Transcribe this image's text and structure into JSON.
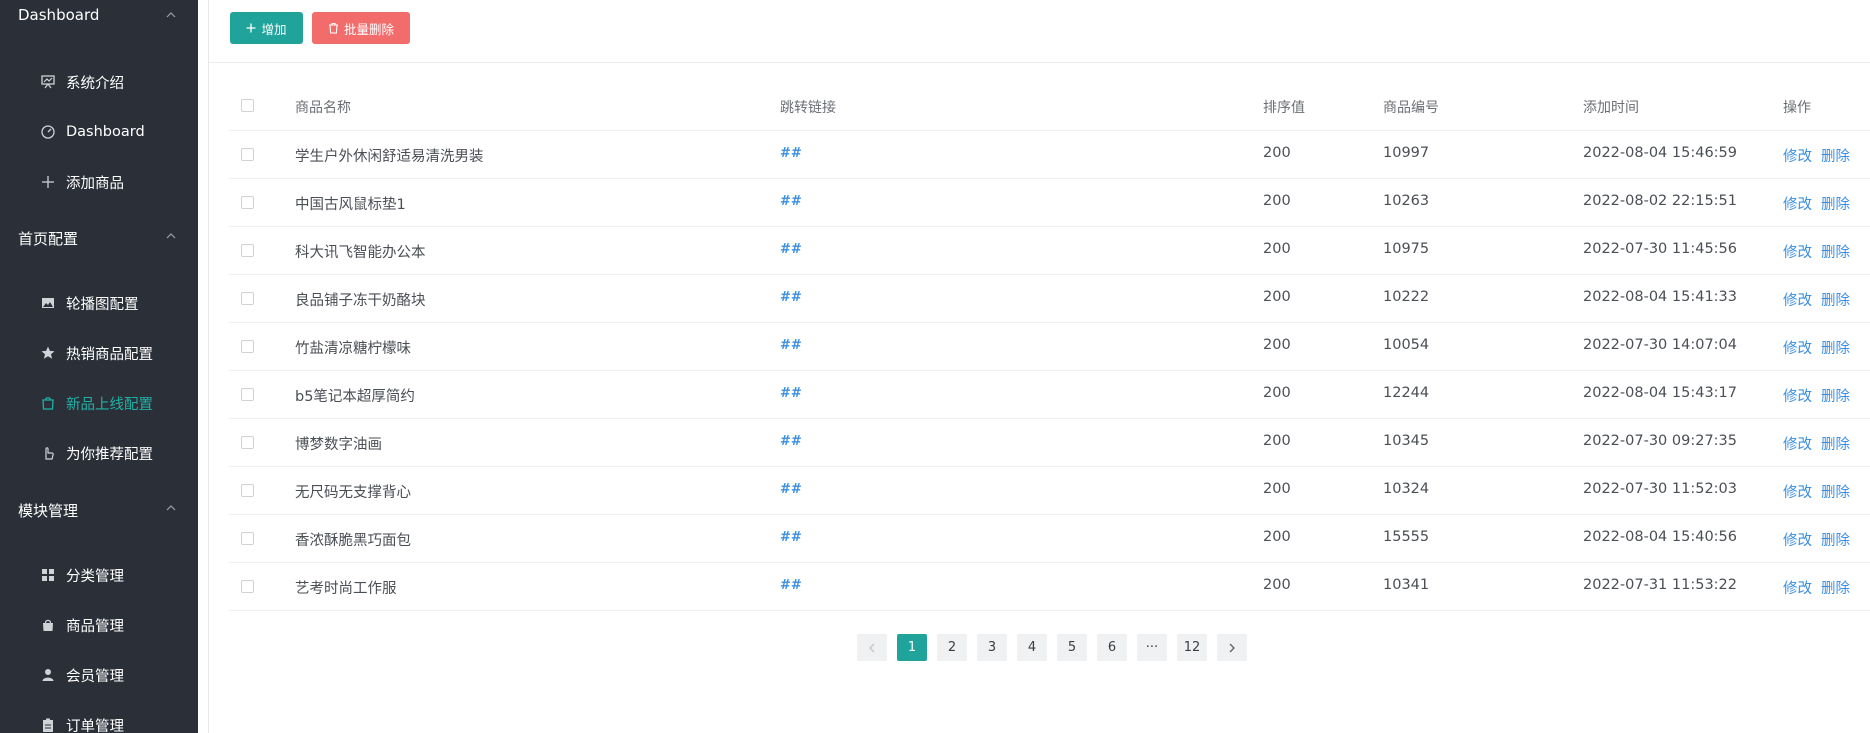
{
  "sidebar": {
    "groups": [
      {
        "title": "Dashboard",
        "items": [
          "系统介绍",
          "Dashboard",
          "添加商品"
        ]
      },
      {
        "title": "首页配置",
        "items": [
          "轮播图配置",
          "热销商品配置",
          "新品上线配置",
          "为你推荐配置"
        ]
      },
      {
        "title": "模块管理",
        "items": [
          "分类管理",
          "商品管理",
          "会员管理",
          "订单管理"
        ]
      }
    ],
    "active_item": "新品上线配置",
    "active_color": "#20b1a5"
  },
  "toolbar": {
    "add_label": "增加",
    "batch_delete_label": "批量删除"
  },
  "table": {
    "headers": [
      "商品名称",
      "跳转链接",
      "排序值",
      "商品编号",
      "添加时间",
      "操作"
    ],
    "rows": [
      {
        "name": "学生户外休闲舒适易清洗男装",
        "link": "##",
        "order": "200",
        "id": "10997",
        "time": "2022-08-04 15:46:59"
      },
      {
        "name": "中国古风鼠标垫1",
        "link": "##",
        "order": "200",
        "id": "10263",
        "time": "2022-08-02 22:15:51"
      },
      {
        "name": "科大讯飞智能办公本",
        "link": "##",
        "order": "200",
        "id": "10975",
        "time": "2022-07-30 11:45:56"
      },
      {
        "name": "良品铺子冻干奶酪块",
        "link": "##",
        "order": "200",
        "id": "10222",
        "time": "2022-08-04 15:41:33"
      },
      {
        "name": "竹盐清凉糖柠檬味",
        "link": "##",
        "order": "200",
        "id": "10054",
        "time": "2022-07-30 14:07:04"
      },
      {
        "name": "b5笔记本超厚简约",
        "link": "##",
        "order": "200",
        "id": "12244",
        "time": "2022-08-04 15:43:17"
      },
      {
        "name": "博梦数字油画",
        "link": "##",
        "order": "200",
        "id": "10345",
        "time": "2022-07-30 09:27:35"
      },
      {
        "name": "无尺码无支撑背心",
        "link": "##",
        "order": "200",
        "id": "10324",
        "time": "2022-07-30 11:52:03"
      },
      {
        "name": "香浓酥脆黑巧面包",
        "link": "##",
        "order": "200",
        "id": "15555",
        "time": "2022-08-04 15:40:56"
      },
      {
        "name": "艺考时尚工作服",
        "link": "##",
        "order": "200",
        "id": "10341",
        "time": "2022-07-31 11:53:22"
      }
    ],
    "edit_label": "修改",
    "delete_label": "删除"
  },
  "pagination": {
    "pages": [
      "1",
      "2",
      "3",
      "4",
      "5",
      "6",
      "···",
      "12"
    ],
    "current": "1"
  },
  "colors": {
    "accent": "#1fa39a",
    "danger": "#f26c6c",
    "link": "#3c8fe0",
    "sidebar_bg": "#2a2f38"
  }
}
